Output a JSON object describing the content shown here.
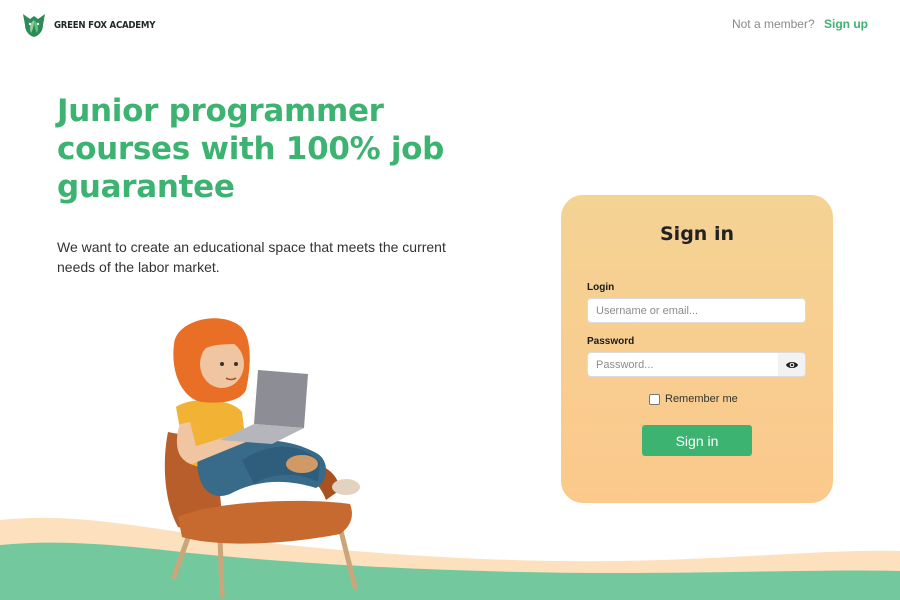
{
  "header": {
    "logo_text": "GREEN FOX ACADEMY",
    "logo_icon": "fox-leaf-icon",
    "member_question": "Not a member?",
    "signup_label": "Sign up"
  },
  "hero": {
    "title": "Junior programmer courses with 100% job guarantee",
    "subtitle": "We want to create an educational space that meets the current needs of the labor market."
  },
  "illustration": {
    "description_icon": "woman-with-laptop-in-armchair-illustration"
  },
  "signin_card": {
    "title": "Sign in",
    "login_label": "Login",
    "login_placeholder": "Username or email...",
    "login_value": "",
    "password_label": "Password",
    "password_placeholder": "Password...",
    "password_value": "",
    "toggle_icon": "eye-icon",
    "remember_label": "Remember me",
    "remember_checked": false,
    "submit_label": "Sign in"
  },
  "colors": {
    "brand_green": "#3cb371",
    "card_gradient_top": "#f4d394",
    "card_gradient_bottom": "#fbc98c",
    "wave_peach": "#fde0bd",
    "wave_green": "#73c99d"
  }
}
